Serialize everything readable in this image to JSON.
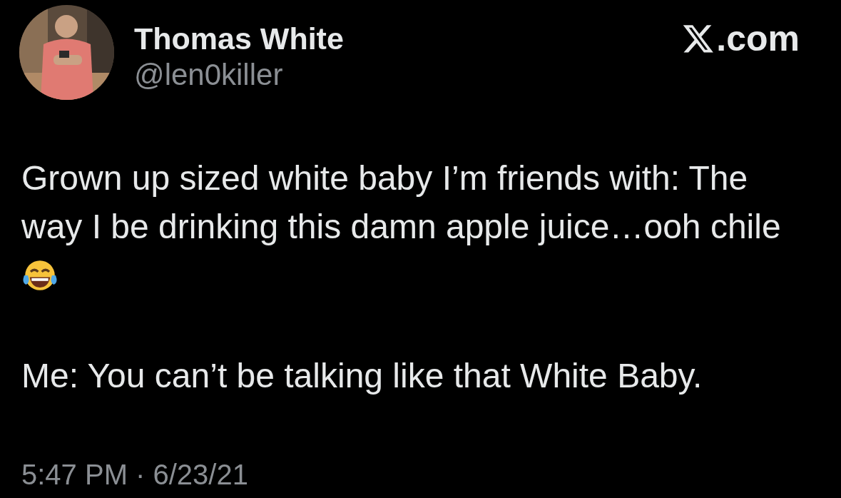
{
  "author": {
    "name": "Thomas White",
    "handle": "@len0killer"
  },
  "brand": {
    "suffix": ".com"
  },
  "paragraphs": [
    {
      "text": "Grown up sized white baby I’m friends with: The\nway I be drinking this damn apple juice…ooh chile",
      "emoji": true
    },
    {
      "text": "Me: You can’t be talking like that White Baby.",
      "emoji": false
    }
  ],
  "timestamp": {
    "time": "5:47 PM",
    "separator": "·",
    "date": "6/23/21"
  }
}
